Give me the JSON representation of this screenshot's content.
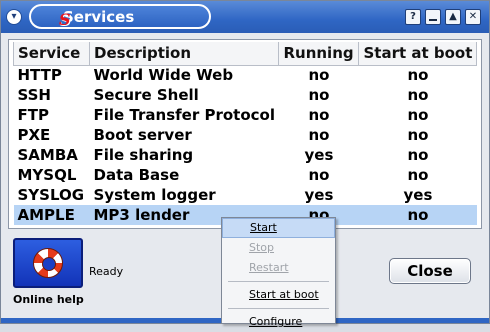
{
  "window": {
    "title": "Services",
    "logo_letter": "S",
    "controls": [
      "help",
      "minimize",
      "maximize",
      "close"
    ]
  },
  "table": {
    "headers": [
      "Service",
      "Description",
      "Running",
      "Start at boot"
    ],
    "rows": [
      {
        "service": "HTTP",
        "description": "World Wide Web",
        "running": "no",
        "boot": "no"
      },
      {
        "service": "SSH",
        "description": "Secure Shell",
        "running": "no",
        "boot": "no"
      },
      {
        "service": "FTP",
        "description": "File Transfer Protocol",
        "running": "no",
        "boot": "no"
      },
      {
        "service": "PXE",
        "description": "Boot server",
        "running": "no",
        "boot": "no"
      },
      {
        "service": "SAMBA",
        "description": "File sharing",
        "running": "yes",
        "boot": "no"
      },
      {
        "service": "MYSQL",
        "description": "Data Base",
        "running": "no",
        "boot": "no"
      },
      {
        "service": "SYSLOG",
        "description": "System logger",
        "running": "yes",
        "boot": "yes"
      },
      {
        "service": "AMPLE",
        "description": "MP3 lender",
        "running": "no",
        "boot": "no"
      }
    ],
    "selected_row": 7
  },
  "context_menu": {
    "start": "Start",
    "stop": "Stop",
    "restart": "Restart",
    "start_at_boot": "Start at boot",
    "configure": "Configure"
  },
  "help": {
    "label": "Online help",
    "icon": "lifebuoy-icon"
  },
  "status": "Ready",
  "close_label": "Close",
  "colors": {
    "titlebar": "#2f66c4",
    "selection": "#b7d4f5",
    "help_button": "#1a3fc4"
  }
}
